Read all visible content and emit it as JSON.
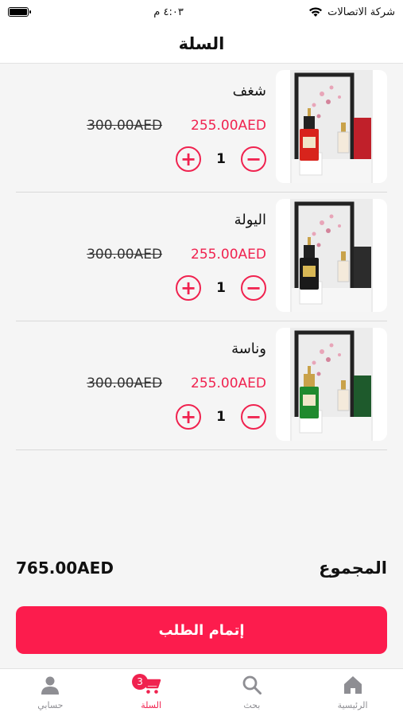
{
  "status_bar": {
    "carrier": "شركة الاتصالات",
    "time": "٤:٠٣ م",
    "battery_level": 1.0
  },
  "header": {
    "title": "السلة"
  },
  "cart": {
    "items": [
      {
        "name": "شغف",
        "sale_price": "255.00AED",
        "original_price": "300.00AED",
        "quantity": "1",
        "bottle_color": "#d8241c"
      },
      {
        "name": "اليولة",
        "sale_price": "255.00AED",
        "original_price": "300.00AED",
        "quantity": "1",
        "bottle_color": "#1a1a1a"
      },
      {
        "name": "وناسة",
        "sale_price": "255.00AED",
        "original_price": "300.00AED",
        "quantity": "1",
        "bottle_color": "#1f8a2e"
      }
    ],
    "increase_icon": "plus-circle-icon",
    "decrease_icon": "minus-circle-icon"
  },
  "summary": {
    "total_label": "المجموع",
    "total_amount": "765.00AED"
  },
  "checkout": {
    "label": "إتمام الطلب"
  },
  "tab_bar": {
    "tabs": [
      {
        "label": "الرئيسية",
        "icon": "home-icon"
      },
      {
        "label": "بحث",
        "icon": "search-icon"
      },
      {
        "label": "السلة",
        "icon": "cart-icon",
        "badge": "3"
      },
      {
        "label": "حسابي",
        "icon": "user-icon"
      }
    ]
  },
  "colors": {
    "accent": "#f0224f",
    "button": "#fc1c4d",
    "inactive_tab": "#8e8e93"
  }
}
